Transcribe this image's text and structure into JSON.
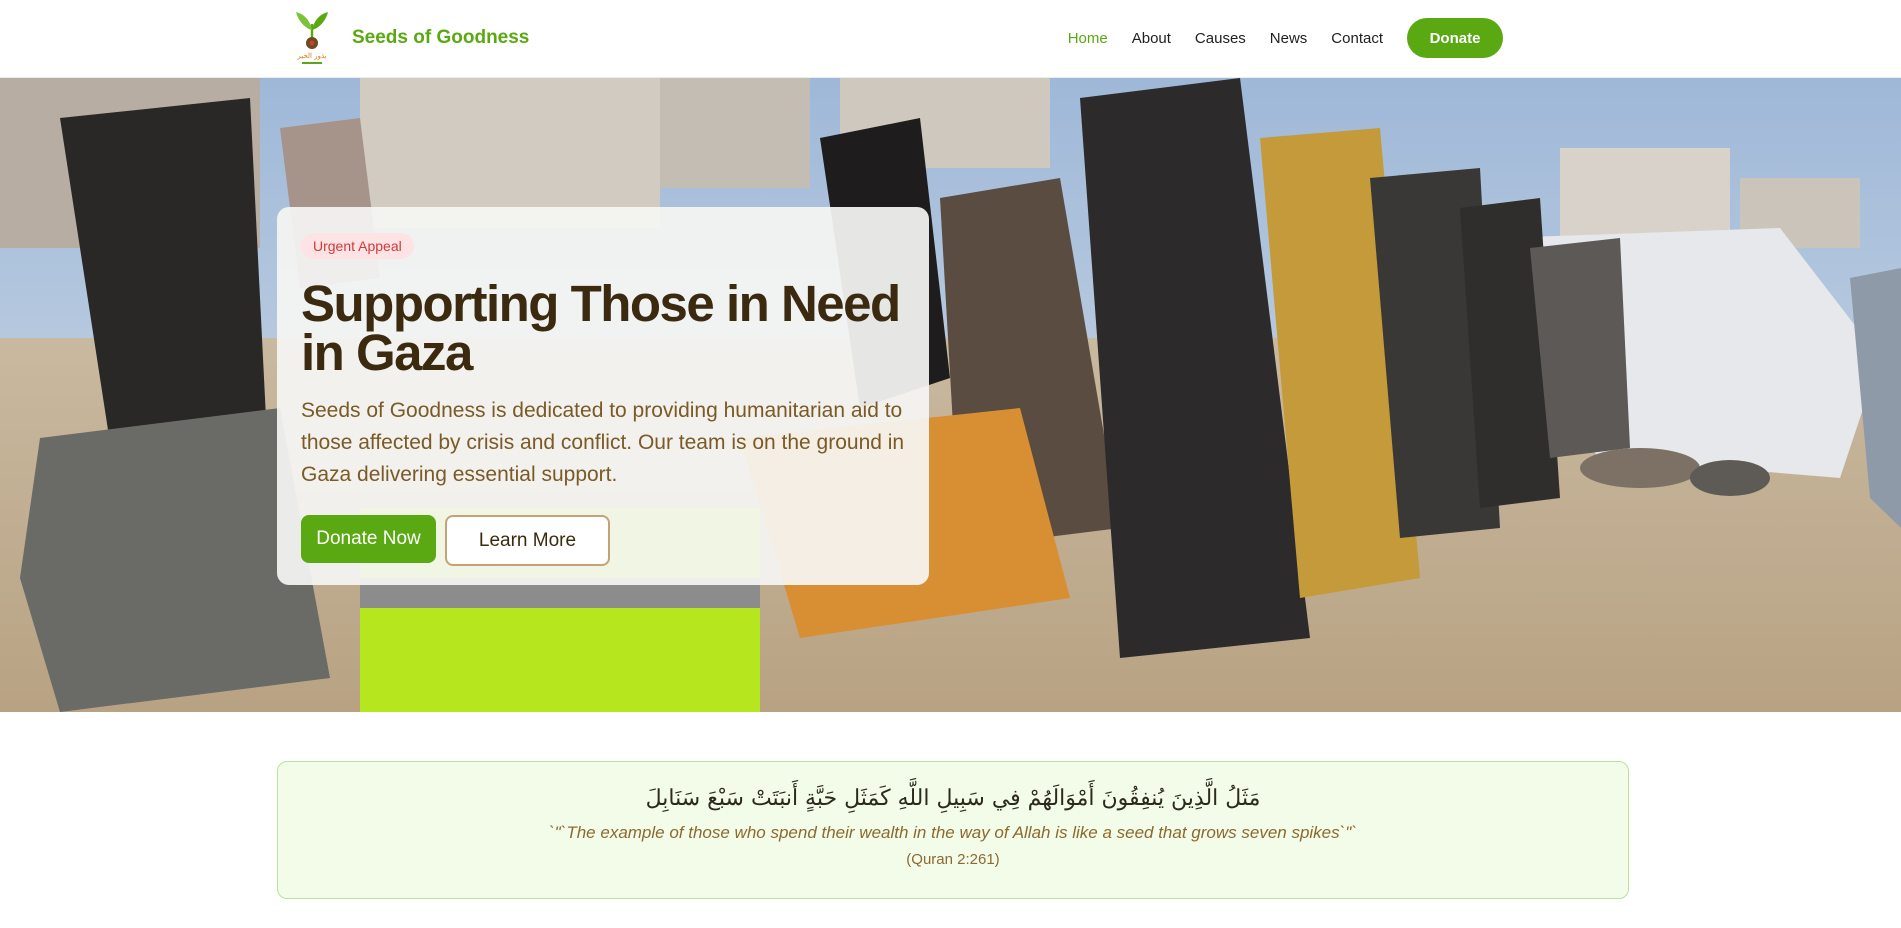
{
  "brand": {
    "name": "Seeds of Goodness",
    "logo_icon": "sprout-logo-icon",
    "logo_caption": "بذور الخير"
  },
  "nav": {
    "items": [
      {
        "label": "Home",
        "active": true
      },
      {
        "label": "About",
        "active": false
      },
      {
        "label": "Causes",
        "active": false
      },
      {
        "label": "News",
        "active": false
      },
      {
        "label": "Contact",
        "active": false
      }
    ],
    "donate_label": "Donate"
  },
  "hero": {
    "badge": "Urgent Appeal",
    "title": "Supporting Those in Need in Gaza",
    "description": "Seeds of Goodness is dedicated to providing humanitarian aid to those affected by crisis and conflict. Our team is on the ground in Gaza delivering essential support.",
    "primary_button": "Donate Now",
    "secondary_button": "Learn More"
  },
  "verse": {
    "arabic": "مَثَلُ الَّذِينَ يُنفِقُونَ أَمْوَالَهُمْ فِي سَبِيلِ اللَّهِ كَمَثَلِ حَبَّةٍ أَنبَتَتْ سَبْعَ سَنَابِلَ",
    "english": "`\"`The example of those who spend their wealth in the way of Allah is like a seed that grows seven spikes`\"`",
    "reference": "(Quran 2:261)"
  },
  "colors": {
    "accent_green": "#5aa812",
    "title_brown": "#3b2a0f",
    "text_brown": "#7a5a26",
    "badge_red": "#d03a3a",
    "verse_bg": "#f3fce8"
  }
}
